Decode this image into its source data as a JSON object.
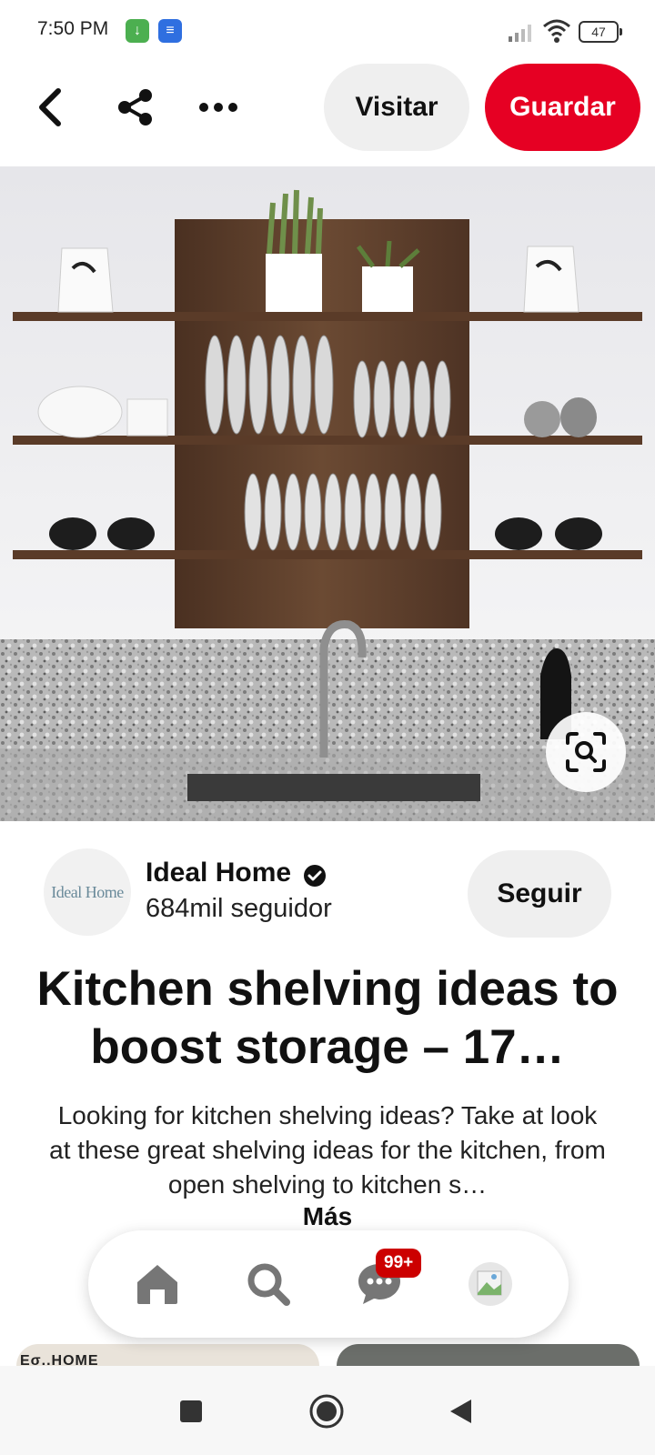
{
  "status_bar": {
    "time": "7:50 PM",
    "battery": "47",
    "icons": [
      "download-notification-icon",
      "message-notification-icon",
      "signal-icon",
      "wifi-icon",
      "battery-icon"
    ]
  },
  "action_bar": {
    "back_icon": "chevron-left-icon",
    "share_icon": "share-icon",
    "more_icon": "more-icon",
    "visit_label": "Visitar",
    "save_label": "Guardar"
  },
  "pin": {
    "visual_search_icon": "visual-search-icon"
  },
  "creator": {
    "logo_text": "Ideal Home",
    "name": "Ideal Home",
    "followers": "684mil seguidor",
    "follow_label": "Seguir"
  },
  "title": "Kitchen shelving ideas to boost storage – 17…",
  "description": "Looking for kitchen shelving ideas? Take at look at these great shelving ideas for the kitchen, from open shelving to kitchen s…",
  "more_label": "Más",
  "related": {
    "card1_peek": "Εσ..ΗΟΜΕ"
  },
  "bottom_nav": {
    "items": [
      "home-icon",
      "search-icon",
      "messages-icon",
      "profile-icon"
    ],
    "messages_badge": "99+"
  },
  "colors": {
    "brand_red": "#e60023",
    "pill_gray": "#efefef",
    "badge_red": "#cc0000"
  }
}
